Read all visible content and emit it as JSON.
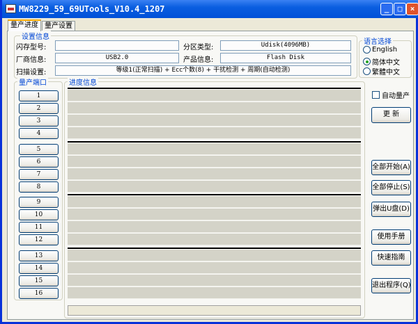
{
  "window": {
    "title": "MW8229_59_69UTools_V10.4_1207",
    "minimize": "_",
    "maximize": "□",
    "close": "×"
  },
  "tabs": [
    {
      "label": "量产进度",
      "active": true
    },
    {
      "label": "量产设置",
      "active": false
    }
  ],
  "settings": {
    "title": "设置信息",
    "flash_model_label": "闪存型号:",
    "flash_model": "",
    "partition_label": "分区类型:",
    "partition": "Udisk(4096MB)",
    "vendor_label": "厂商信息:",
    "vendor": "USB2.0",
    "product_label": "产品信息:",
    "product": "Flash Disk",
    "scan_label": "扫描设置:",
    "scan": "等级1(正常扫描) + Ecc个数(8) + 干扰检测 + 周期(自动检测)"
  },
  "language": {
    "title": "语言选择",
    "options": [
      "English",
      "简体中文",
      "繁體中文"
    ],
    "selected": "简体中文"
  },
  "ports": {
    "title": "量产端口",
    "labels": [
      "1",
      "2",
      "3",
      "4",
      "5",
      "6",
      "7",
      "8",
      "9",
      "10",
      "11",
      "12",
      "13",
      "14",
      "15",
      "16"
    ]
  },
  "progress": {
    "title": "进度信息"
  },
  "auto_mp": {
    "label": "自动量产",
    "checked": false
  },
  "buttons": {
    "refresh": "更  新",
    "start_all": "全部开始(A)",
    "stop_all": "全部停止(S)",
    "eject": "弹出U盘(D)",
    "manual": "使用手册",
    "guide": "快速指南",
    "exit": "退出程序(Q)"
  }
}
